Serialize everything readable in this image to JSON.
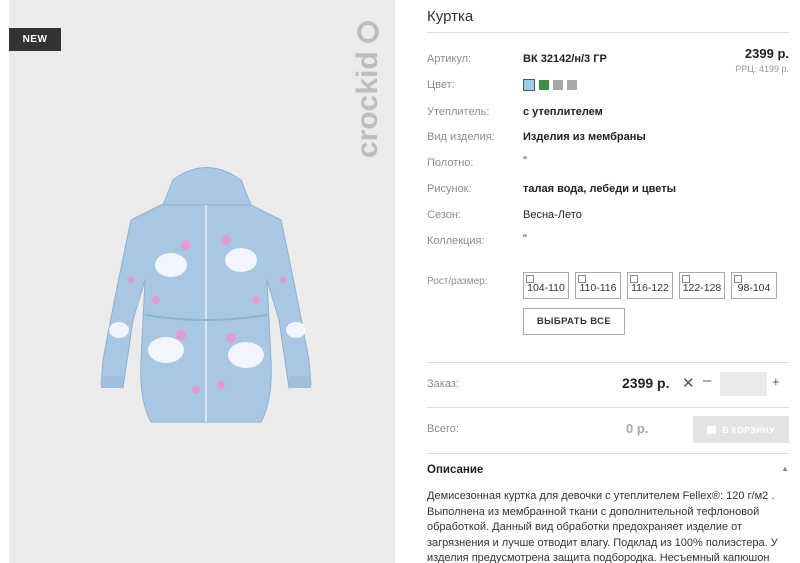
{
  "badge": "NEW",
  "brand": "crockid",
  "product": {
    "title": "Куртка",
    "price": "2399 р.",
    "rrp": "РРЦ: 4199 р."
  },
  "attributes": [
    {
      "label": "Артикул:",
      "value": "ВК 32142/н/3 ГР",
      "bold": true
    },
    {
      "label": "Цвет:",
      "value": ""
    },
    {
      "label": "Утеплитель:",
      "value": "с утеплителем",
      "bold": true
    },
    {
      "label": "Вид изделия:",
      "value": "Изделия из мембраны",
      "bold": true
    },
    {
      "label": "Полотно:",
      "value": "\"",
      "bold": false
    },
    {
      "label": "Рисунок:",
      "value": "талая вода, лебеди и цветы",
      "bold": true
    },
    {
      "label": "Сезон:",
      "value": "Весна-Лето",
      "bold": false
    },
    {
      "label": "Коллекция:",
      "value": "\"",
      "bold": false
    }
  ],
  "colors": {
    "swatches": [
      "#9ccbe9",
      "#3a8c4a",
      "#a8a8a8",
      "#a8a8a8"
    ],
    "selected_index": 0
  },
  "sizes": {
    "label": "Рост/размер:",
    "options": [
      "104-110",
      "110-116",
      "116-122",
      "122-128",
      "98-104"
    ],
    "select_all": "ВЫБРАТЬ ВСЕ"
  },
  "order": {
    "label": "Заказ:",
    "price": "2399 р.",
    "remove": "✕",
    "minus": "–",
    "plus": "+",
    "quantity": ""
  },
  "total": {
    "label": "Всего:",
    "price": "0 р.",
    "cart_button": "В КОРЗИНУ"
  },
  "description": {
    "title": "Описание",
    "toggle": "▲",
    "text": "Демисезонная куртка для девочки с утеплителем Fellex®: 120 г/м2 . Выполнена из мембранной ткани с дополнительной тефлоновой обработкой. Данный вид обработки предохраняет изделие от загрязнения и лучше отводит влагу. Подклад из 100% полиэстера. У изделия предусмотрена защита подбородка. Несъемный капюшон"
  }
}
